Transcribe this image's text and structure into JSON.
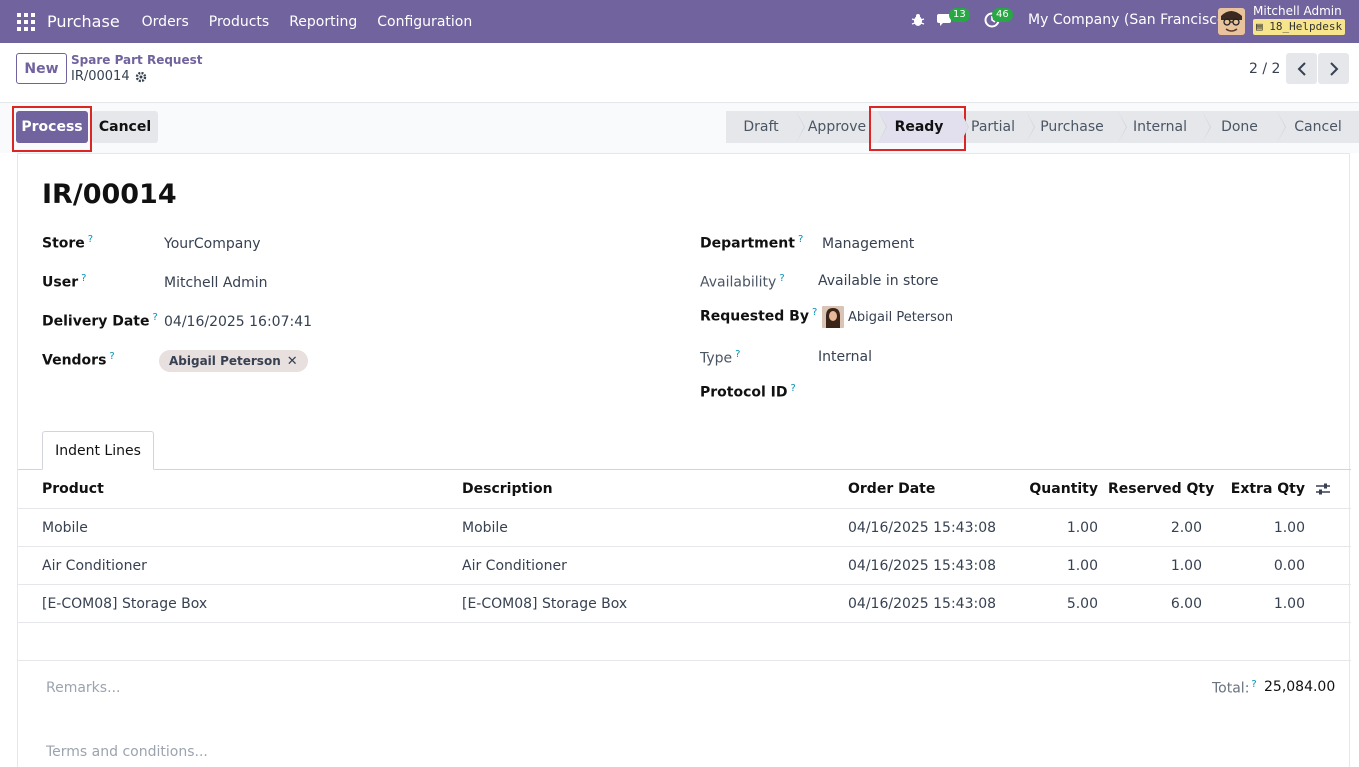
{
  "navbar": {
    "app_name": "Purchase",
    "menu": [
      "Orders",
      "Products",
      "Reporting",
      "Configuration"
    ],
    "chat_count": "13",
    "activity_count": "46",
    "company": "My Company (San Francisco)",
    "user_name": "Mitchell Admin",
    "database": "18_Helpdesk",
    "accent_color": "#71639e"
  },
  "control": {
    "new_label": "New",
    "breadcrumb": "Spare Part Request",
    "record_ref": "IR/00014",
    "pager": "2 / 2"
  },
  "actions": {
    "process_label": "Process",
    "cancel_label": "Cancel"
  },
  "statusbar": {
    "stages": [
      "Draft",
      "Approve",
      "Ready",
      "Partial",
      "Purchase",
      "Internal",
      "Done",
      "Cancel"
    ],
    "active": "Ready"
  },
  "form": {
    "title": "IR/00014",
    "left": [
      {
        "label": "Store",
        "value": "YourCompany"
      },
      {
        "label": "User",
        "value": "Mitchell Admin"
      },
      {
        "label": "Delivery Date",
        "value": "04/16/2025 16:07:41"
      },
      {
        "label": "Vendors",
        "value": "Abigail Peterson"
      }
    ],
    "right": [
      {
        "label": "Department",
        "value": "Management"
      },
      {
        "label": "Availability",
        "value": "Available in store"
      },
      {
        "label": "Requested By",
        "value": "Abigail Peterson"
      },
      {
        "label": "Type",
        "value": "Internal"
      },
      {
        "label": "Protocol ID",
        "value": ""
      }
    ],
    "help_mark": "?"
  },
  "tabs": {
    "indent_lines": "Indent Lines"
  },
  "table": {
    "columns": [
      "Product",
      "Description",
      "Order Date",
      "Quantity",
      "Reserved Qty",
      "Extra Qty"
    ],
    "rows": [
      [
        "Mobile",
        "Mobile",
        "04/16/2025 15:43:08",
        "1.00",
        "2.00",
        "1.00"
      ],
      [
        "Air Conditioner",
        "Air Conditioner",
        "04/16/2025 15:43:08",
        "1.00",
        "1.00",
        "0.00"
      ],
      [
        "[E-COM08] Storage Box",
        "[E-COM08] Storage Box",
        "04/16/2025 15:43:08",
        "5.00",
        "6.00",
        "1.00"
      ]
    ]
  },
  "footer": {
    "remarks_placeholder": "Remarks...",
    "total_label": "Total:",
    "total_value": "25,084.00",
    "terms_placeholder": "Terms and conditions..."
  }
}
